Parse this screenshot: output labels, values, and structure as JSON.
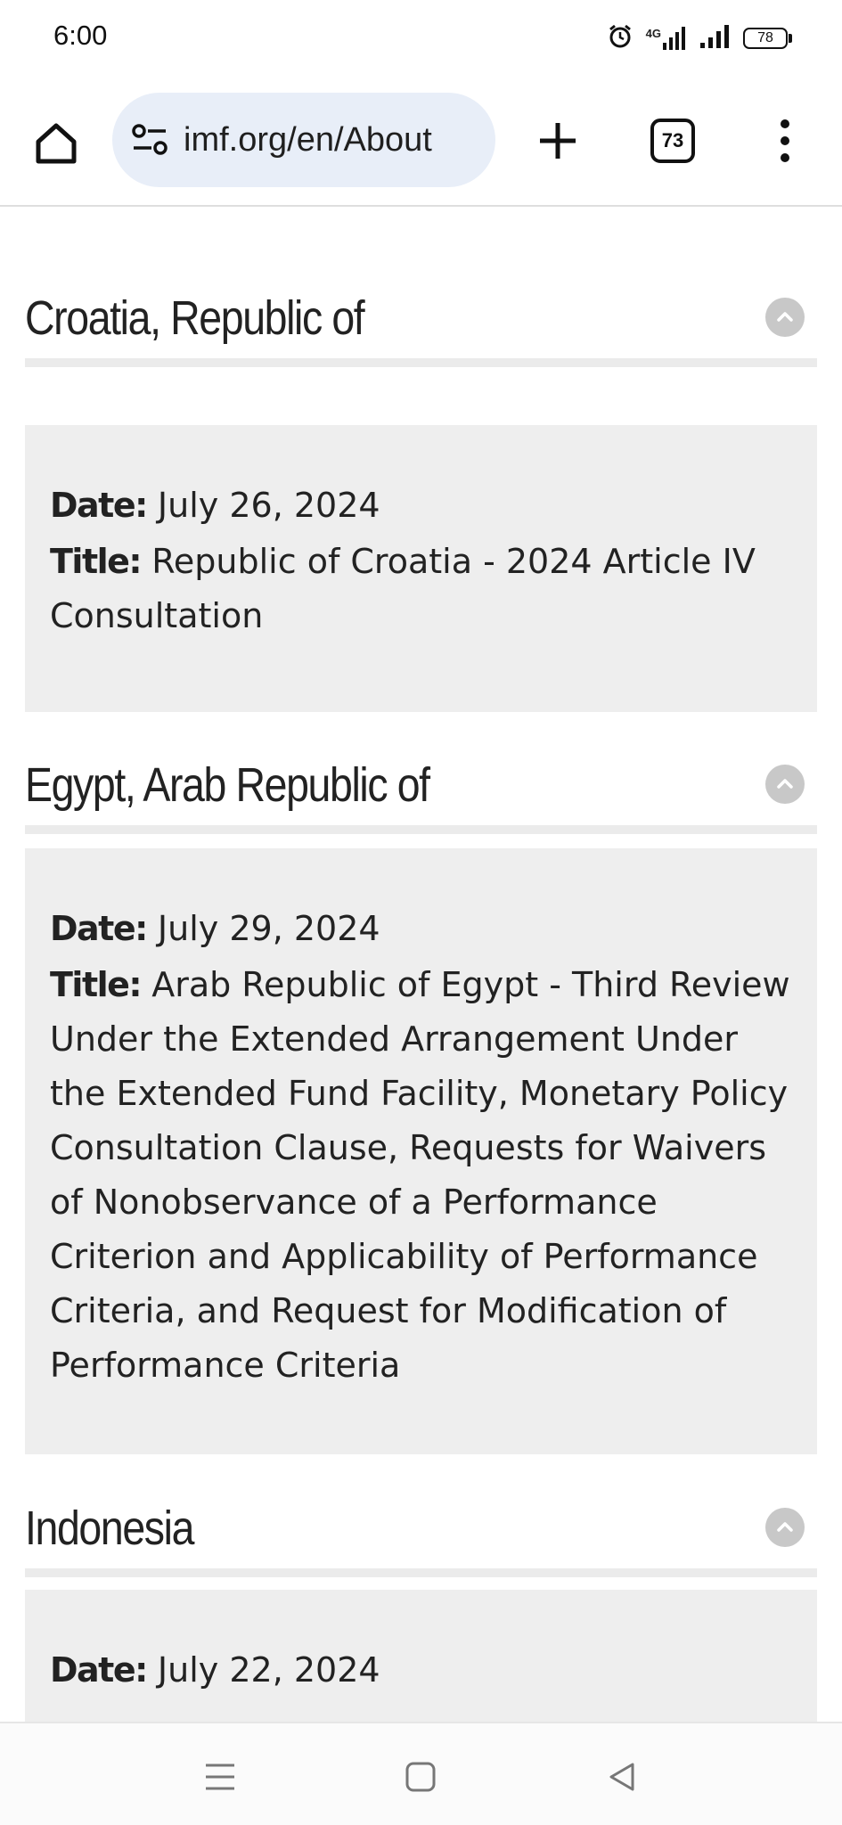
{
  "status": {
    "time": "6:00",
    "battery": "78",
    "network": "4G"
  },
  "browser": {
    "url": "imf.org/en/About",
    "tab_count": "73"
  },
  "sections": [
    {
      "name": "Croatia, Republic of",
      "date_label": "Date:",
      "date": "July 26, 2024",
      "title_label": "Title:",
      "title": "Republic of Croatia - 2024 Article IV Consultation"
    },
    {
      "name": "Egypt, Arab Republic of",
      "date_label": "Date:",
      "date": "July 29, 2024",
      "title_label": "Title:",
      "title": "Arab Republic of Egypt - Third Review Under the Extended Arrangement Under the Extended Fund Facility, Monetary Policy Consultation Clause, Requests for Waivers of Nonobservance of a Performance Criterion and Applicability of Performance Criteria, and Request for Modification of Performance Criteria"
    },
    {
      "name": "Indonesia",
      "date_label": "Date:",
      "date": "July 22, 2024"
    }
  ]
}
